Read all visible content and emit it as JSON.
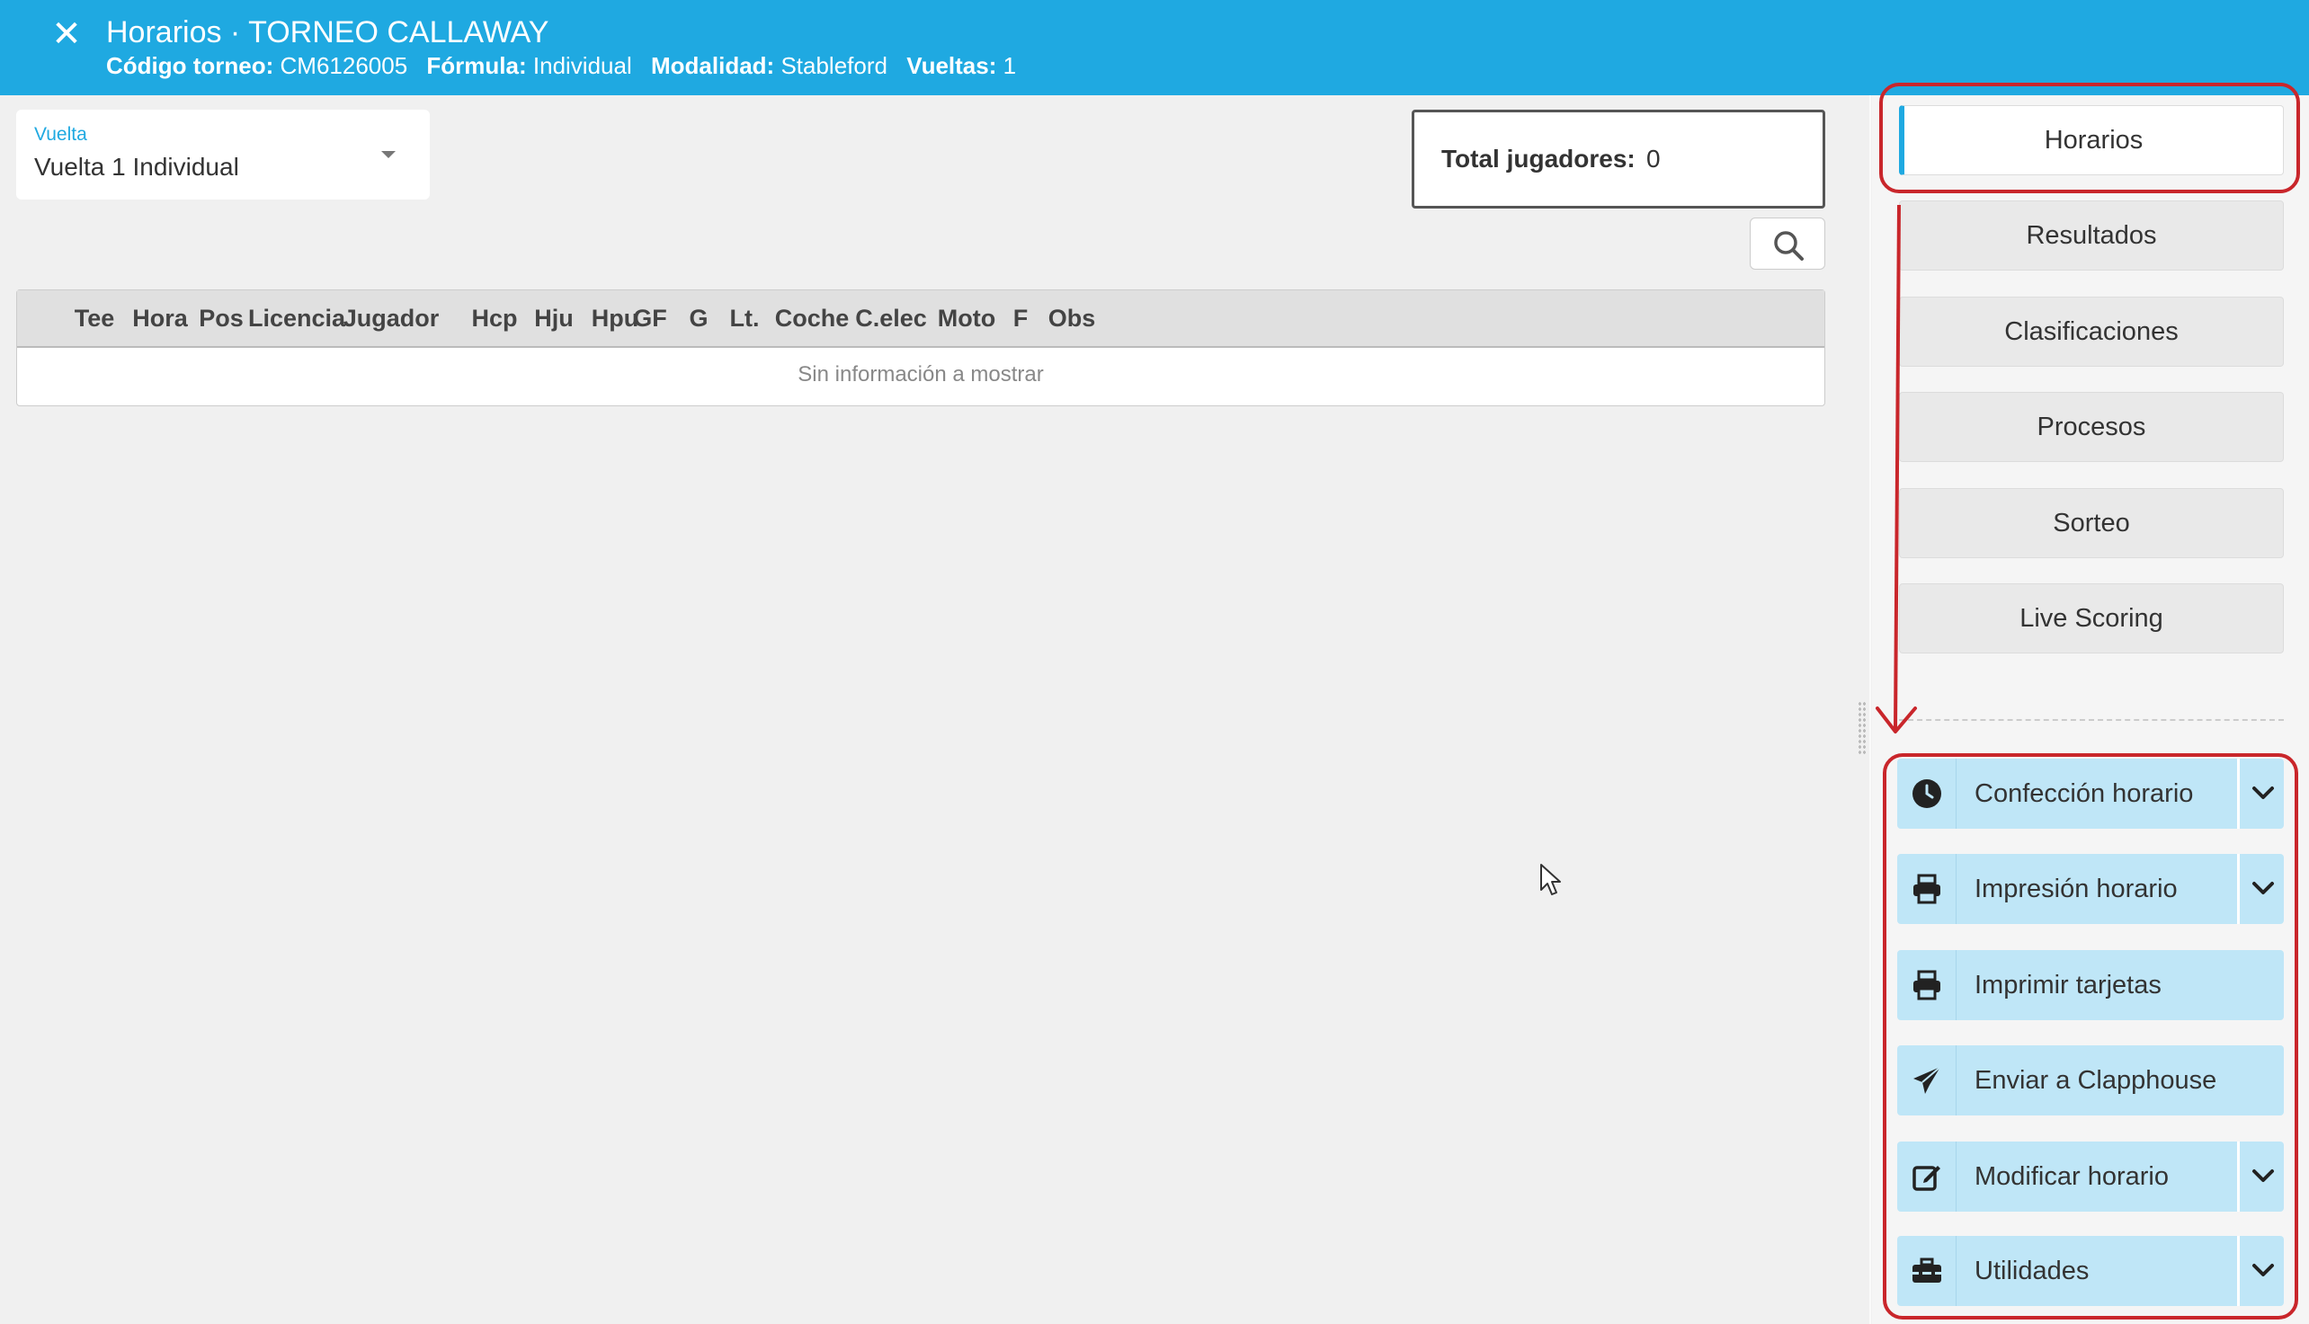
{
  "header": {
    "close_glyph": "✕",
    "title": "Horarios · TORNEO CALLAWAY",
    "codigo_label": "Código torneo:",
    "codigo_value": "CM6126005",
    "formula_label": "Fórmula:",
    "formula_value": "Individual",
    "modalidad_label": "Modalidad:",
    "modalidad_value": "Stableford",
    "vueltas_label": "Vueltas:",
    "vueltas_value": "1"
  },
  "vuelta_select": {
    "label": "Vuelta",
    "value": "Vuelta 1 Individual"
  },
  "total": {
    "label": "Total jugadores:",
    "value": "0"
  },
  "table": {
    "columns": [
      "Tee",
      "Hora",
      "Pos",
      "Licencia",
      "Jugador",
      "Hcp",
      "Hju",
      "Hpu",
      "GF",
      "G",
      "Lt.",
      "Coche",
      "C.elec",
      "Moto",
      "F",
      "Obs"
    ],
    "empty_message": "Sin información a mostrar"
  },
  "nav": {
    "items": [
      "Horarios",
      "Resultados",
      "Clasificaciones",
      "Procesos",
      "Sorteo",
      "Live Scoring"
    ],
    "active": "Horarios"
  },
  "actions": [
    {
      "label": "Confección horario",
      "icon": "clock-icon",
      "dropdown": true
    },
    {
      "label": "Impresión horario",
      "icon": "printer-icon",
      "dropdown": true
    },
    {
      "label": "Imprimir tarjetas",
      "icon": "printer-icon",
      "dropdown": false
    },
    {
      "label": "Enviar a Clapphouse",
      "icon": "paper-plane-icon",
      "dropdown": false
    },
    {
      "label": "Modificar horario",
      "icon": "edit-icon",
      "dropdown": true
    },
    {
      "label": "Utilidades",
      "icon": "toolbox-icon",
      "dropdown": true
    }
  ],
  "colors": {
    "header_blue": "#1fa9e1",
    "action_bg": "#bfe6f7",
    "annotation_red": "#c9262b"
  }
}
